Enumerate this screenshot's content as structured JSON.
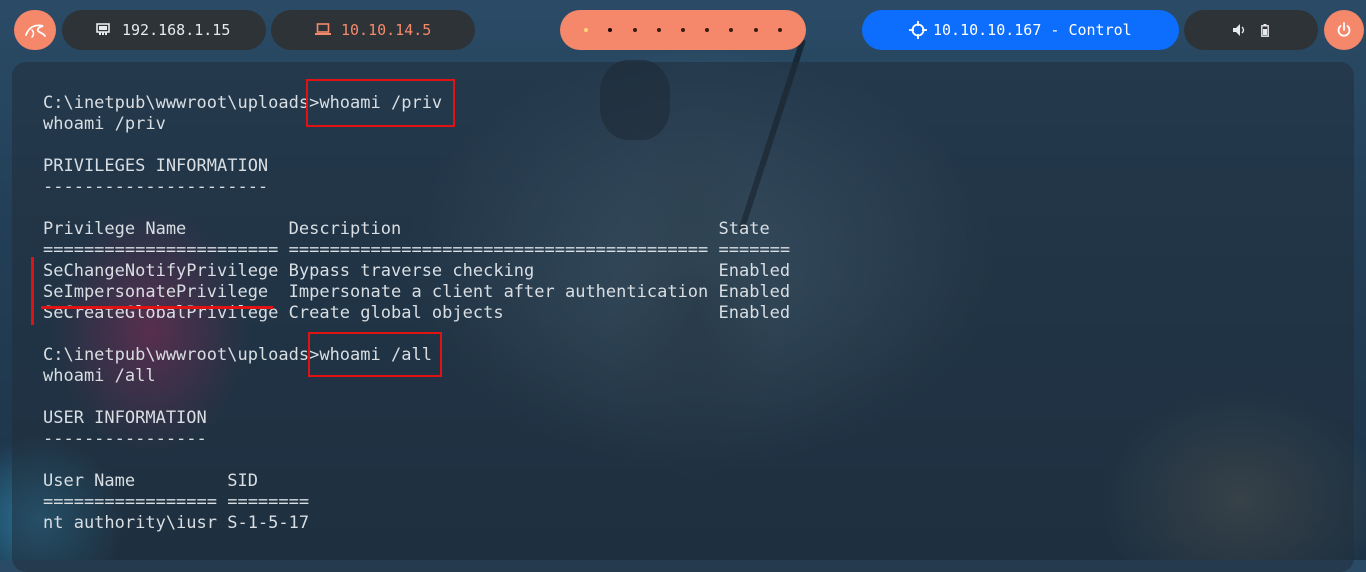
{
  "topbar": {
    "local_ip": "192.168.1.15",
    "vpn_ip": "10.10.14.5",
    "target": "10.10.10.167 - Control",
    "workspaces": [
      "1",
      "2",
      "3",
      "4",
      "5",
      "6",
      "7",
      "8",
      "9"
    ],
    "accent": "#f5876a",
    "target_color": "#0d6efd"
  },
  "terminal": {
    "lines": [
      "C:\\inetpub\\wwwroot\\uploads>whoami /priv",
      "whoami /priv",
      "",
      "PRIVILEGES INFORMATION",
      "----------------------",
      "",
      "Privilege Name          Description                               State",
      "======================= ========================================= =======",
      "SeChangeNotifyPrivilege Bypass traverse checking                  Enabled",
      "SeImpersonatePrivilege  Impersonate a client after authentication Enabled",
      "SeCreateGlobalPrivilege Create global objects                     Enabled",
      "",
      "C:\\inetpub\\wwwroot\\uploads>whoami /all",
      "whoami /all",
      "",
      "USER INFORMATION",
      "----------------",
      "",
      "User Name         SID",
      "================= ========",
      "nt authority\\iusr S-1-5-17"
    ]
  }
}
